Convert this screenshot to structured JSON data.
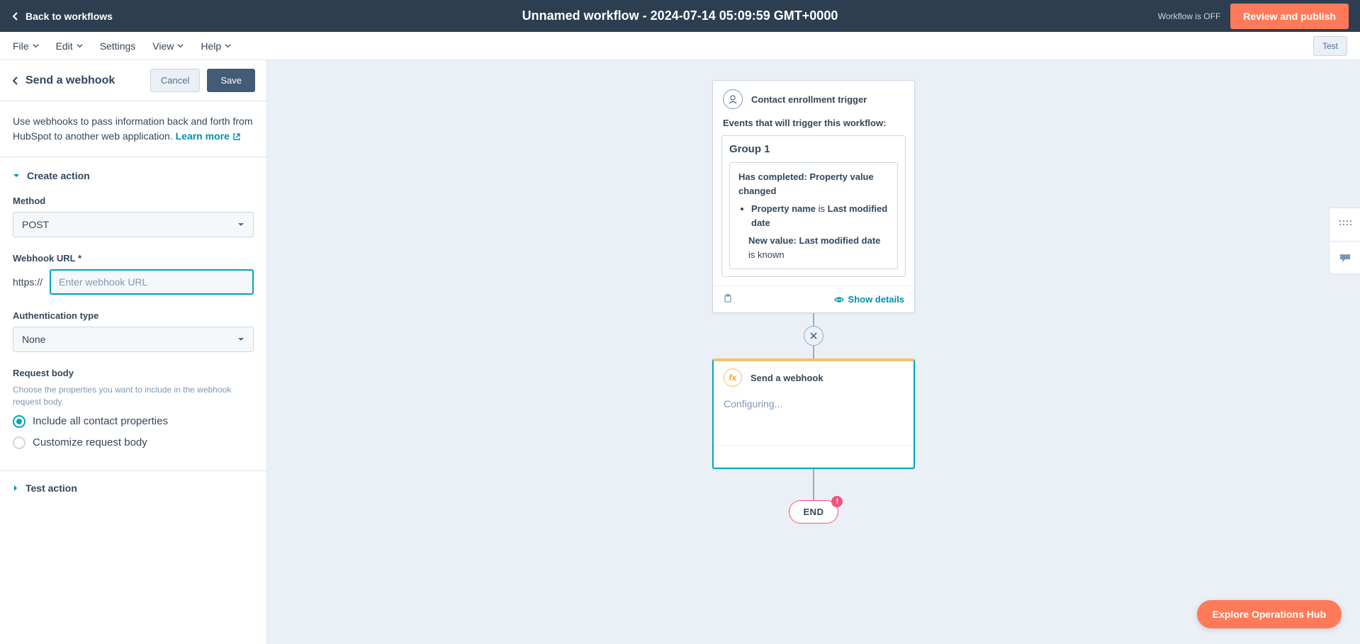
{
  "topbar": {
    "back": "Back to workflows",
    "title": "Unnamed workflow - 2024-07-14 05:09:59 GMT+0000",
    "status": "Workflow is OFF",
    "review": "Review and publish"
  },
  "menubar": {
    "file": "File",
    "edit": "Edit",
    "settings": "Settings",
    "view": "View",
    "help": "Help",
    "test": "Test"
  },
  "panel": {
    "title": "Send a webhook",
    "cancel": "Cancel",
    "save": "Save",
    "intro": "Use webhooks to pass information back and forth from HubSpot to another web application.",
    "learn_more": "Learn more",
    "create_action": "Create action",
    "method_label": "Method",
    "method_value": "POST",
    "url_label": "Webhook URL *",
    "url_prefix": "https://",
    "url_placeholder": "Enter webhook URL",
    "auth_label": "Authentication type",
    "auth_value": "None",
    "body_label": "Request body",
    "body_sub": "Choose the properties you want to include in the webhook request body.",
    "radio_all": "Include all contact properties",
    "radio_custom": "Customize request body",
    "test_action": "Test action"
  },
  "canvas": {
    "trigger_title": "Contact enrollment trigger",
    "trigger_sub": "Events that will trigger this workflow:",
    "group_title": "Group 1",
    "event_heading_bold": "Has completed: Property value changed",
    "prop_label": "Property name",
    "prop_is": " is ",
    "prop_value": "Last modified date",
    "newval_label": "New value: Last modified date",
    "newval_suffix": " is known",
    "show_details": "Show details",
    "webhook_title": "Send a webhook",
    "webhook_status": "Configuring...",
    "end": "END",
    "end_badge": "!"
  },
  "explore": "Explore Operations Hub"
}
